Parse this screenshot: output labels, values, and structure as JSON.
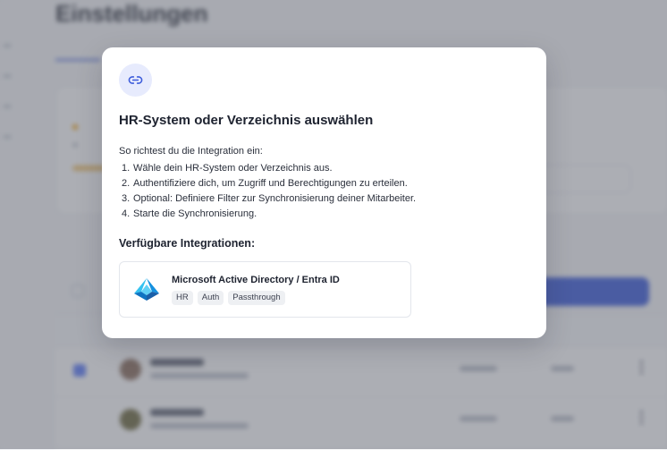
{
  "background": {
    "page_title": "Einstellungen"
  },
  "modal": {
    "icon": "link-icon",
    "title": "HR-System oder Verzeichnis auswählen",
    "intro": "So richtest du die Integration ein:",
    "steps": [
      {
        "num": "1.",
        "text": "Wähle dein HR-System oder Verzeichnis aus."
      },
      {
        "num": "2.",
        "text": "Authentifiziere dich, um Zugriff und Berechtigungen zu erteilen."
      },
      {
        "num": "3.",
        "text": "Optional: Definiere Filter zur Synchronisierung deiner Mitarbeiter."
      },
      {
        "num": "4.",
        "text": "Starte die Synchronisierung."
      }
    ],
    "available_title": "Verfügbare Integrationen:",
    "integrations": [
      {
        "name": "Microsoft Active Directory / Entra ID",
        "logo": "entra-id-logo",
        "tags": [
          "HR",
          "Auth",
          "Passthrough"
        ]
      }
    ]
  },
  "colors": {
    "accent": "#3b5bdb",
    "icon_bg": "#e7ebfd",
    "entra_blue": "#1490df"
  }
}
